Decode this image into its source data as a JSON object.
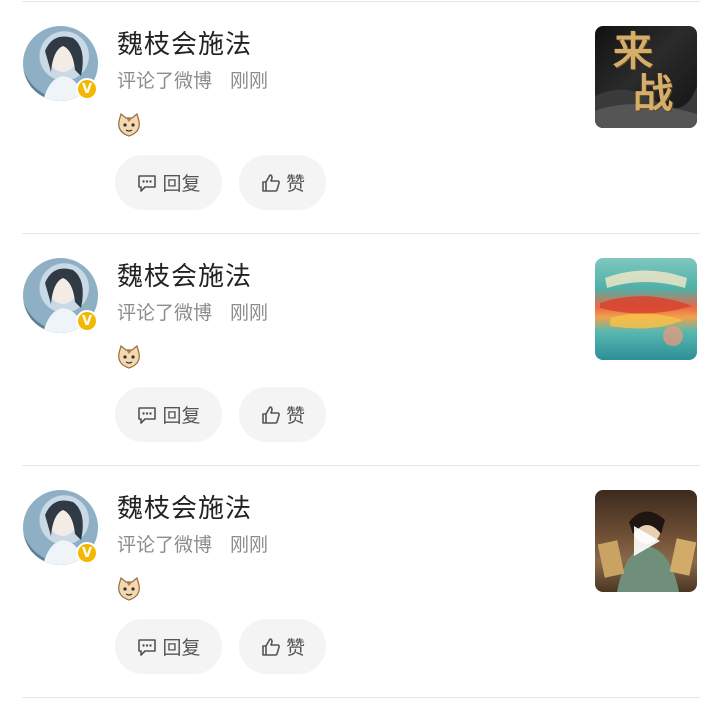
{
  "icons": {
    "reply": "comment-bubble-icon",
    "like": "thumbs-up-icon",
    "verified": "verified-v-icon",
    "emoji": "cat-emoji-icon"
  },
  "colors": {
    "verified_badge": "#f5b800",
    "button_bg": "#f4f4f4",
    "meta_text": "#8c8c8c"
  },
  "items": [
    {
      "username": "魏枝会施法",
      "action": "评论了微博",
      "time": "刚刚",
      "verified_mark": "V",
      "reply_label": "回复",
      "like_label": "赞",
      "thumbnail": {
        "kind": "image",
        "title_text": [
          "来",
          "战"
        ]
      }
    },
    {
      "username": "魏枝会施法",
      "action": "评论了微博",
      "time": "刚刚",
      "verified_mark": "V",
      "reply_label": "回复",
      "like_label": "赞",
      "thumbnail": {
        "kind": "image"
      }
    },
    {
      "username": "魏枝会施法",
      "action": "评论了微博",
      "time": "刚刚",
      "verified_mark": "V",
      "reply_label": "回复",
      "like_label": "赞",
      "thumbnail": {
        "kind": "video"
      }
    }
  ]
}
